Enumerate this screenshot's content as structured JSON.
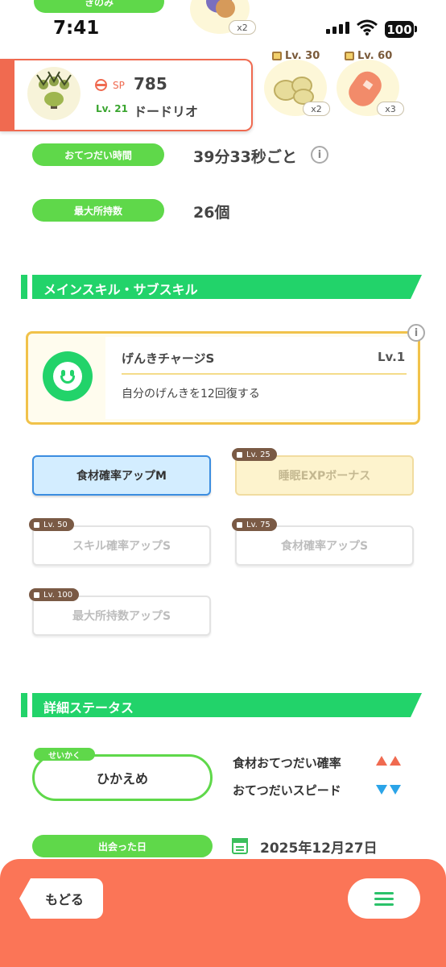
{
  "status_bar": {
    "time": "7:41",
    "battery": "100"
  },
  "top_pill": {
    "label": "きのみ"
  },
  "ingredients": [
    {
      "count": "x2",
      "lock": ""
    },
    {
      "count": "x2",
      "lock": "Lv. 30"
    },
    {
      "count": "x3",
      "lock": "Lv. 60"
    }
  ],
  "pokemon": {
    "sp_label": "SP",
    "sp_value": "785",
    "level": "Lv. 21",
    "name": "ドードリオ"
  },
  "stats": {
    "help_time_label": "おてつだい時間",
    "help_time_value": "39分33秒ごと",
    "max_carry_label": "最大所持数",
    "max_carry_value": "26個"
  },
  "skills_section": {
    "title": "メインスキル・サブスキル",
    "main_skill": {
      "name": "げんきチャージS",
      "level": "Lv.1",
      "description": "自分のげんきを12回復する"
    },
    "sub_skills": [
      {
        "label": "食材確率アップM",
        "lock": ""
      },
      {
        "label": "睡眠EXPボーナス",
        "lock": "Lv. 25"
      },
      {
        "label": "スキル確率アップS",
        "lock": "Lv. 50"
      },
      {
        "label": "食材確率アップS",
        "lock": "Lv. 75"
      },
      {
        "label": "最大所持数アップS",
        "lock": "Lv. 100"
      }
    ]
  },
  "detail_section": {
    "title": "詳細ステータス",
    "nature_tag": "せいかく",
    "nature": "ひかえめ",
    "effects": [
      {
        "label": "食材おてつだい確率",
        "direction": "up"
      },
      {
        "label": "おてつだいスピード",
        "direction": "down"
      }
    ],
    "met_label": "出会った日",
    "met_date": "2025年12月27日"
  },
  "bottom": {
    "back_label": "もどる"
  },
  "colors": {
    "accent_green": "#22d36a",
    "accent_orange": "#fb7557",
    "up": "#f06a50",
    "down": "#2ba4e8"
  }
}
